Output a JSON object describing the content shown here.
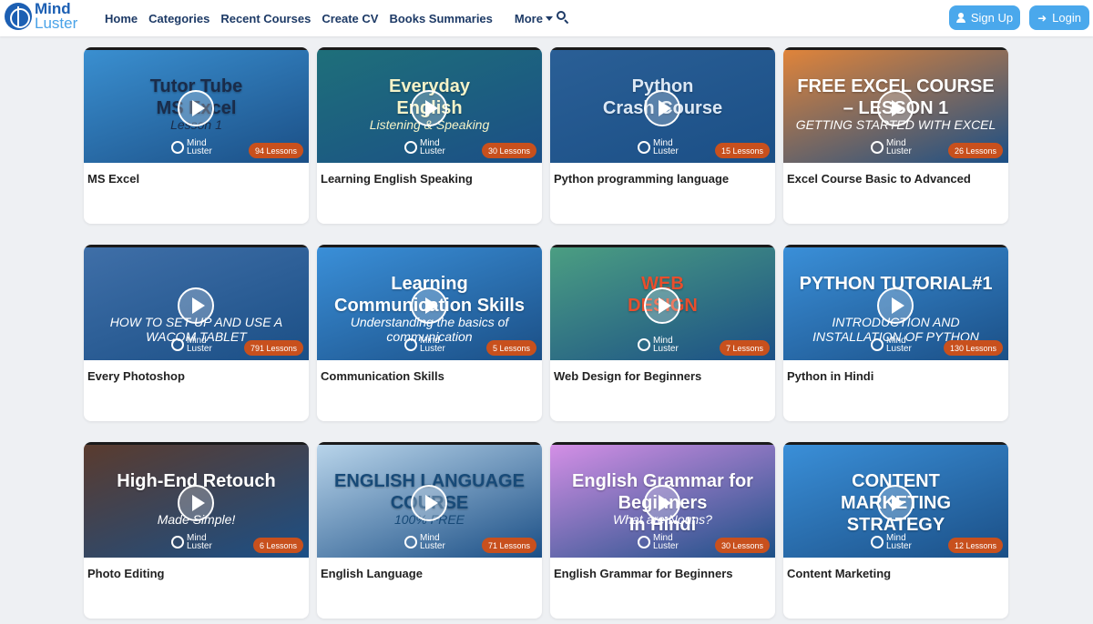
{
  "brand": {
    "line1": "Mind",
    "line2": "Luster"
  },
  "nav": {
    "home": "Home",
    "categories": "Categories",
    "recent": "Recent Courses",
    "cv": "Create CV",
    "books": "Books Summaries",
    "more": "More"
  },
  "auth": {
    "signup": "Sign Up",
    "login": "Login"
  },
  "watermark": {
    "line1": "Mind",
    "line2": "Luster"
  },
  "courses": [
    {
      "title": "MS Excel",
      "lessons": "94 Lessons",
      "thumb_title": "Tutor Tube\nMS Excel",
      "thumb_sub": "Lesson 1",
      "bg": "#3a8fd0",
      "fg": "#1a2c4a"
    },
    {
      "title": "Learning English Speaking",
      "lessons": "30 Lessons",
      "thumb_title": "Everyday\nEnglish",
      "thumb_sub": "Listening & Speaking",
      "bg": "#1e6f7a",
      "fg": "#f4f3c8"
    },
    {
      "title": "Python programming language",
      "lessons": "15 Lessons",
      "thumb_title": "Python\nCrash Course",
      "thumb_sub": "",
      "bg": "#2a5f96",
      "fg": "#dce8f5"
    },
    {
      "title": "Excel Course Basic to Advanced",
      "lessons": "26 Lessons",
      "thumb_title": "FREE EXCEL COURSE – LESSON 1",
      "thumb_sub": "GETTING STARTED WITH EXCEL",
      "bg": "#e0843a",
      "fg": "#ffffff"
    },
    {
      "title": "Every Photoshop",
      "lessons": "791 Lessons",
      "thumb_title": "",
      "thumb_sub": "HOW TO SET UP AND USE A WACOM TABLET",
      "bg": "#3f6fa8",
      "fg": "#ffffff"
    },
    {
      "title": "Communication Skills",
      "lessons": "5 Lessons",
      "thumb_title": "Learning Communication Skills",
      "thumb_sub": "Understanding the basics of communication",
      "bg": "#3a8fd8",
      "fg": "#ffffff"
    },
    {
      "title": "Web Design for Beginners",
      "lessons": "7 Lessons",
      "thumb_title": "WEB\nDESIGN",
      "thumb_sub": "",
      "bg": "#4b9e82",
      "fg": "#e94e2c"
    },
    {
      "title": "Python in Hindi",
      "lessons": "130 Lessons",
      "thumb_title": "PYTHON TUTORIAL#1",
      "thumb_sub": "INTRODUCTION AND INSTALLATION OF PYTHON",
      "bg": "#3a8fd8",
      "fg": "#ffffff"
    },
    {
      "title": "Photo Editing",
      "lessons": "6 Lessons",
      "thumb_title": "High-End Retouch",
      "thumb_sub": "Made Simple!",
      "bg": "#5a3b2e",
      "fg": "#ffffff"
    },
    {
      "title": "English Language",
      "lessons": "71 Lessons",
      "thumb_title": "ENGLISH LANGUAGE\nCOURSE",
      "thumb_sub": "100% FREE",
      "bg": "#b8d4ea",
      "fg": "#174a78"
    },
    {
      "title": "English Grammar for Beginners",
      "lessons": "30 Lessons",
      "thumb_title": "English Grammar for Beginners\nIn Hindi",
      "thumb_sub": "What are Nouns?",
      "bg": "#d48fe6",
      "fg": "#ffffff"
    },
    {
      "title": "Content Marketing",
      "lessons": "12 Lessons",
      "thumb_title": "CONTENT\nMARKETING\nSTRATEGY",
      "thumb_sub": "",
      "bg": "#3a8fd8",
      "fg": "#ffffff"
    }
  ]
}
